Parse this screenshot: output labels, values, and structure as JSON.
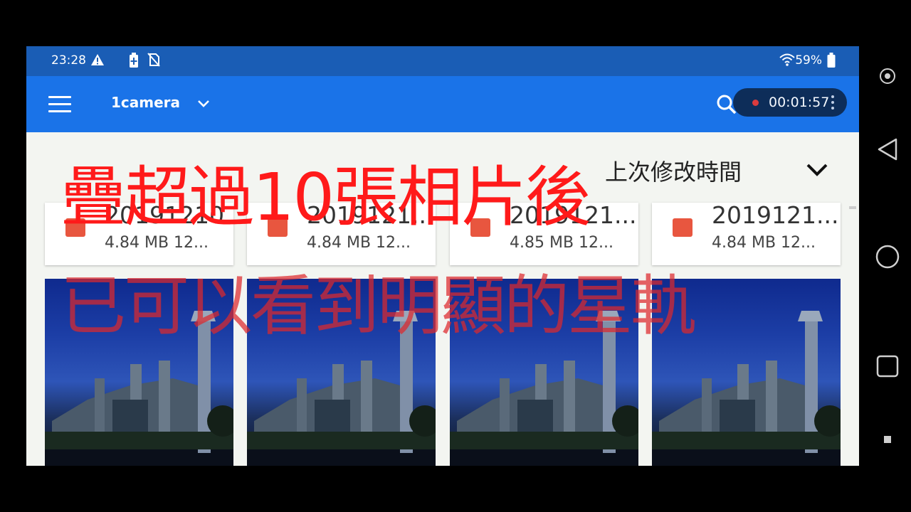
{
  "status_bar": {
    "time": "23:28",
    "icons": [
      "warning-icon",
      "battery-saver-icon",
      "no-sim-icon",
      "wifi-icon",
      "battery-icon"
    ],
    "battery_pct": "59%"
  },
  "app_bar": {
    "folder_title": "1camera",
    "recording": {
      "time": "00:01:57"
    }
  },
  "sort": {
    "label": "上次修改時間"
  },
  "files": [
    {
      "name": "20191210...",
      "meta": "4.84 MB 12..."
    },
    {
      "name": "2019121...",
      "meta": "4.84 MB 12..."
    },
    {
      "name": "2019121...",
      "meta": "4.85 MB 12..."
    },
    {
      "name": "2019121...",
      "meta": "4.84 MB 12..."
    }
  ],
  "overlay": {
    "line1": "疊超過10張相片後",
    "line2": "已可以看到明顯的星軌"
  },
  "colors": {
    "status_bar": "#1a5db5",
    "app_bar": "#1a73e8",
    "overlay_red": "#ff1a1a"
  },
  "nav_bar": [
    "record-icon",
    "back-icon",
    "home-icon",
    "recents-icon",
    "stop-icon"
  ]
}
